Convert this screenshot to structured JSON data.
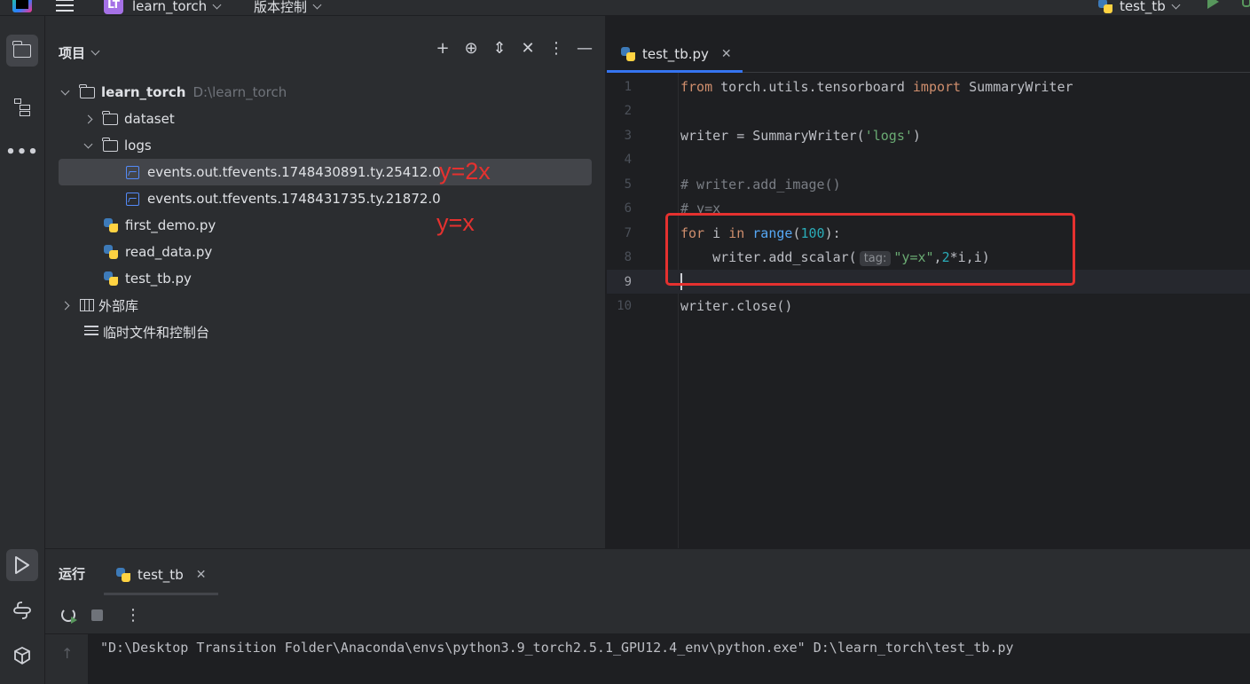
{
  "titlebar": {
    "project_badge": "LT",
    "project_name": "learn_torch",
    "vcs_menu": "版本控制",
    "run_config": "test_tb"
  },
  "project_panel": {
    "title": "项目",
    "tree": [
      {
        "label": "learn_torch",
        "path": "D:\\learn_torch"
      },
      {
        "label": "dataset"
      },
      {
        "label": "logs"
      },
      {
        "label": "events.out.tfevents.1748430891.ty.25412.0"
      },
      {
        "label": "events.out.tfevents.1748431735.ty.21872.0"
      },
      {
        "label": "first_demo.py"
      },
      {
        "label": "read_data.py"
      },
      {
        "label": "test_tb.py"
      },
      {
        "label": "外部库"
      },
      {
        "label": "临时文件和控制台"
      }
    ],
    "annotations": [
      "y=2x",
      "y=x"
    ]
  },
  "editor": {
    "tab_label": "test_tb.py",
    "line_numbers": [
      "1",
      "2",
      "3",
      "4",
      "5",
      "6",
      "7",
      "8",
      "9",
      "10"
    ],
    "inlay_hint": "tag:",
    "code": {
      "l1_kw1": "from",
      "l1_mod": " torch.utils.tensorboard ",
      "l1_kw2": "import",
      "l1_name": " SummaryWriter",
      "l3_a": "writer = SummaryWriter(",
      "l3_str": "'logs'",
      "l3_b": ")",
      "l5": "# writer.add_image()",
      "l6": "# y=x",
      "l7_kw1": "for",
      "l7_a": " i ",
      "l7_kw2": "in",
      "l7_sp": " ",
      "l7_fn": "range",
      "l7_b": "(",
      "l7_num": "100",
      "l7_c": "):",
      "l8_a": "    writer.add_scalar(",
      "l8_str": "\"y=x\"",
      "l8_b": ",",
      "l8_num": "2",
      "l8_c": "*i,i)",
      "l10": "writer.close()"
    }
  },
  "run_panel": {
    "title": "运行",
    "tab_label": "test_tb",
    "console_line": "\"D:\\Desktop Transition Folder\\Anaconda\\envs\\python3.9_torch2.5.1_GPU12.4_env\\python.exe\" D:\\learn_torch\\test_tb.py"
  },
  "icons": [
    "pycharm-logo-icon",
    "hamburger-menu-icon",
    "folder-icon",
    "structure-icon",
    "more-icon",
    "run-icon",
    "python-console-icon",
    "packages-icon",
    "add-icon",
    "locate-icon",
    "expand-all-icon",
    "collapse-all-icon",
    "options-icon",
    "hide-icon",
    "rerun-icon",
    "stop-icon",
    "scroll-up-icon",
    "debug-icon"
  ],
  "colors": {
    "accent": "#3574f0",
    "annotation_red": "#e5312f",
    "run_green": "#57965c"
  }
}
